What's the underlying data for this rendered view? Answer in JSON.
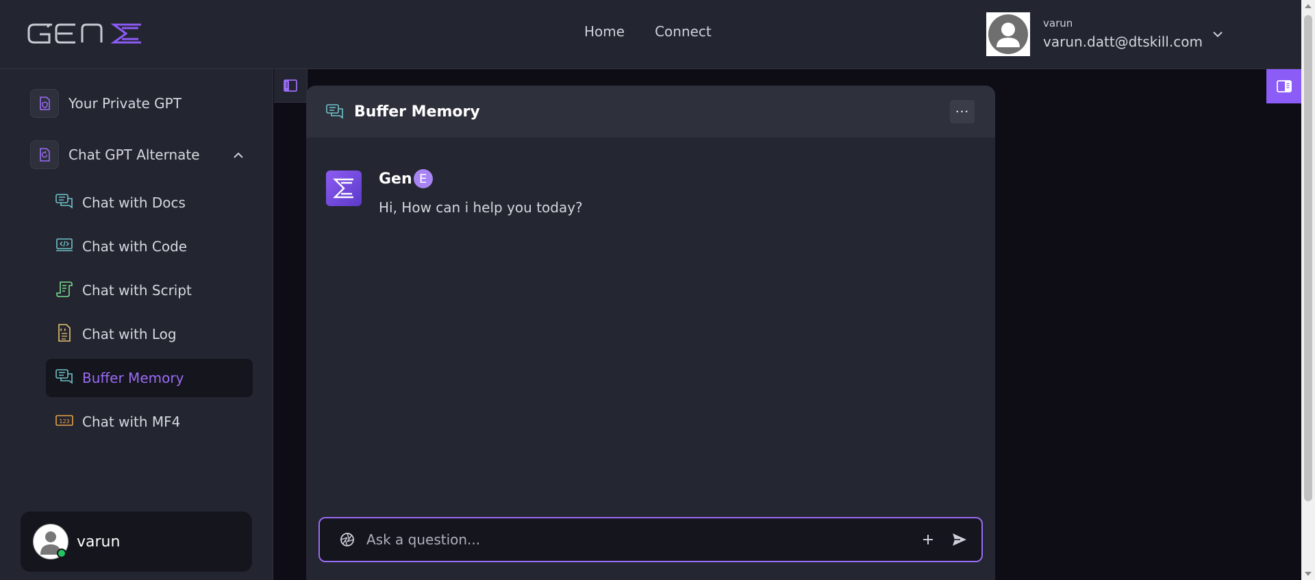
{
  "brand": {
    "logo_alt": "GENE logo",
    "accent": "#9b6cf6"
  },
  "nav": {
    "home": "Home",
    "connect": "Connect"
  },
  "account": {
    "username": "varun",
    "email": "varun.datt@dtskill.com"
  },
  "sidebar": {
    "sections": [
      {
        "label": "Your Private GPT",
        "icon": "shield-document-icon"
      },
      {
        "label": "Chat GPT Alternate",
        "icon": "refresh-document-icon",
        "expanded": true
      }
    ],
    "items": [
      {
        "label": "Chat with Docs",
        "icon": "chat-bubbles-icon"
      },
      {
        "label": "Chat with Code",
        "icon": "code-monitor-icon"
      },
      {
        "label": "Chat with Script",
        "icon": "script-scroll-icon"
      },
      {
        "label": "Chat with Log",
        "icon": "log-file-icon"
      },
      {
        "label": "Buffer Memory",
        "icon": "chat-bubbles-icon",
        "active": true
      },
      {
        "label": "Chat with MF4",
        "icon": "numeric-card-icon"
      }
    ],
    "user": {
      "name": "varun"
    }
  },
  "chat": {
    "title": "Buffer Memory",
    "more_label": "···",
    "bot": {
      "name_prefix": "Gen",
      "name_badge": "E",
      "message": "Hi, How can i help you today?"
    },
    "input": {
      "placeholder": "Ask a question..."
    }
  }
}
